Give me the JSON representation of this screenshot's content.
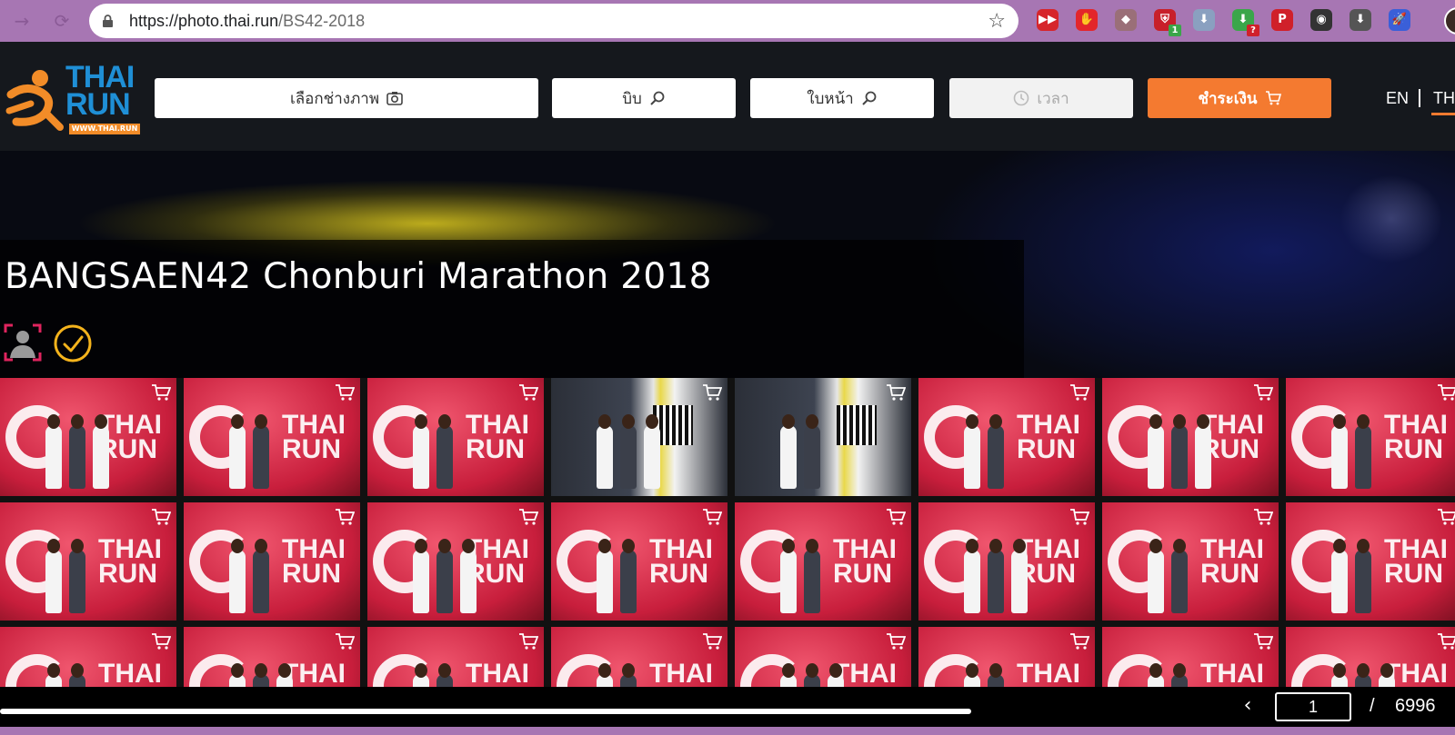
{
  "browser": {
    "url_host": "https://photo.thai.run",
    "url_path": "/BS42-2018",
    "extensions": [
      {
        "name": "extension-red-ff-icon",
        "color": "#d6252b",
        "glyph": "▶▶",
        "badge": ""
      },
      {
        "name": "adblock-hand-icon",
        "color": "#e3262b",
        "glyph": "✋",
        "badge": ""
      },
      {
        "name": "extension-orange-icon",
        "color": "#9a6f78",
        "glyph": "◆",
        "badge": ""
      },
      {
        "name": "shield-icon",
        "color": "#c8202a",
        "glyph": "⛨",
        "badge": "1"
      },
      {
        "name": "download-arrow-icon",
        "color": "#8aa0c0",
        "glyph": "⬇",
        "badge": ""
      },
      {
        "name": "download-green-icon",
        "color": "#3aa64a",
        "glyph": "⬇",
        "badge": "?"
      },
      {
        "name": "pinterest-icon",
        "color": "#d0202a",
        "glyph": "P",
        "badge": ""
      },
      {
        "name": "screen-record-icon",
        "color": "#333333",
        "glyph": "◉",
        "badge": ""
      },
      {
        "name": "download-dark-icon",
        "color": "#555555",
        "glyph": "⬇",
        "badge": ""
      },
      {
        "name": "rocket-icon",
        "color": "#3a5fd8",
        "glyph": "🚀",
        "badge": ""
      }
    ]
  },
  "header": {
    "logo_line1": "THAI",
    "logo_line2": "RUN",
    "logo_sub": "WWW.THAI.RUN",
    "filters": {
      "photographer": "เลือกช่างภาพ",
      "bib": "บิบ",
      "face": "ใบหน้า",
      "time": "เวลา",
      "pay": "ชำระเงิน"
    },
    "lang_en": "EN",
    "lang_th": "TH"
  },
  "event": {
    "title": "BANGSAEN42 Chonburi Marathon 2018"
  },
  "colors": {
    "accent": "#f47a30",
    "brand_blue": "#1f8fd6",
    "browser_chrome": "#a776b3"
  },
  "pagination": {
    "current": "1",
    "separator": "/",
    "total": "6996",
    "progress": 0.81
  }
}
